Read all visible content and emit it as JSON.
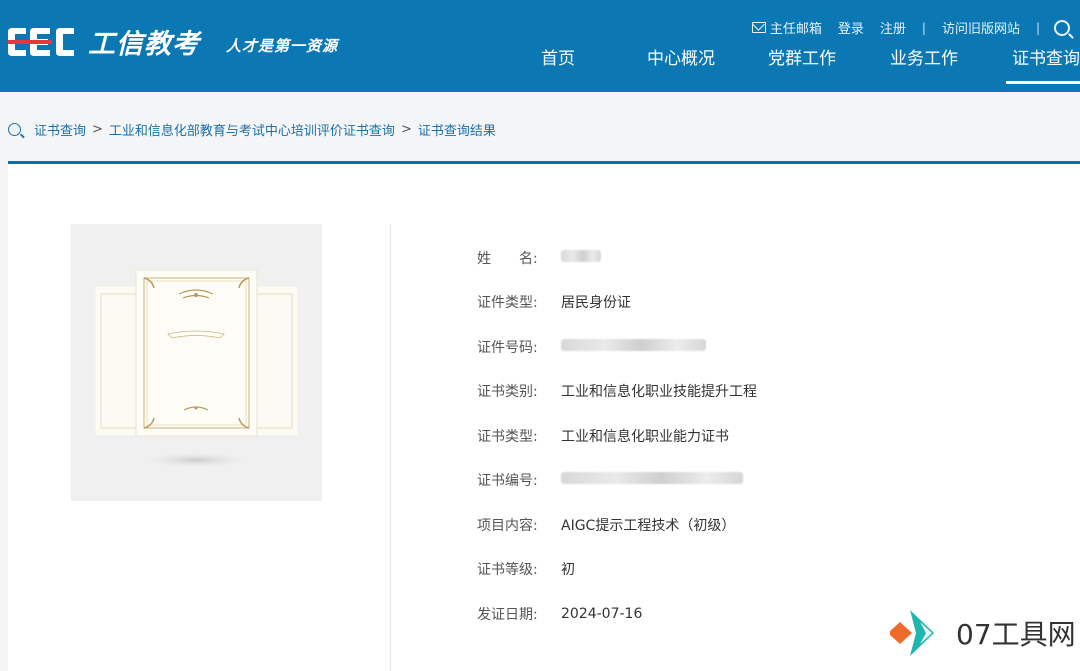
{
  "header": {
    "logo_text": "工信教考",
    "slogan": "人才是第一资源",
    "top_links": {
      "mail": "主任邮箱",
      "login": "登录",
      "register": "注册",
      "old_site": "访问旧版网站"
    },
    "nav": [
      {
        "label": "首页"
      },
      {
        "label": "中心概况"
      },
      {
        "label": "党群工作"
      },
      {
        "label": "业务工作"
      },
      {
        "label": "证书查询"
      }
    ],
    "active_nav": "证书查询"
  },
  "breadcrumb": {
    "items": [
      "证书查询",
      "工业和信息化部教育与考试中心培训评价证书查询",
      "证书查询结果"
    ]
  },
  "certificate": {
    "fields": [
      {
        "label": "姓　　名:",
        "value": ""
      },
      {
        "label": "证件类型:",
        "value": "居民身份证"
      },
      {
        "label": "证件号码:",
        "value": ""
      },
      {
        "label": "证书类别:",
        "value": "工业和信息化职业技能提升工程"
      },
      {
        "label": "证书类型:",
        "value": "工业和信息化职业能力证书"
      },
      {
        "label": "证书编号:",
        "value": ""
      },
      {
        "label": "项目内容:",
        "value": "AIGC提示工程技术（初级）"
      },
      {
        "label": "证书等级:",
        "value": "初"
      },
      {
        "label": "发证日期:",
        "value": "2024-07-16"
      }
    ]
  },
  "watermark": {
    "text": "07工具网"
  },
  "colors": {
    "header_bg": "#0b78b4",
    "accent": "#0b6fb0",
    "link": "#1d6fa5"
  }
}
